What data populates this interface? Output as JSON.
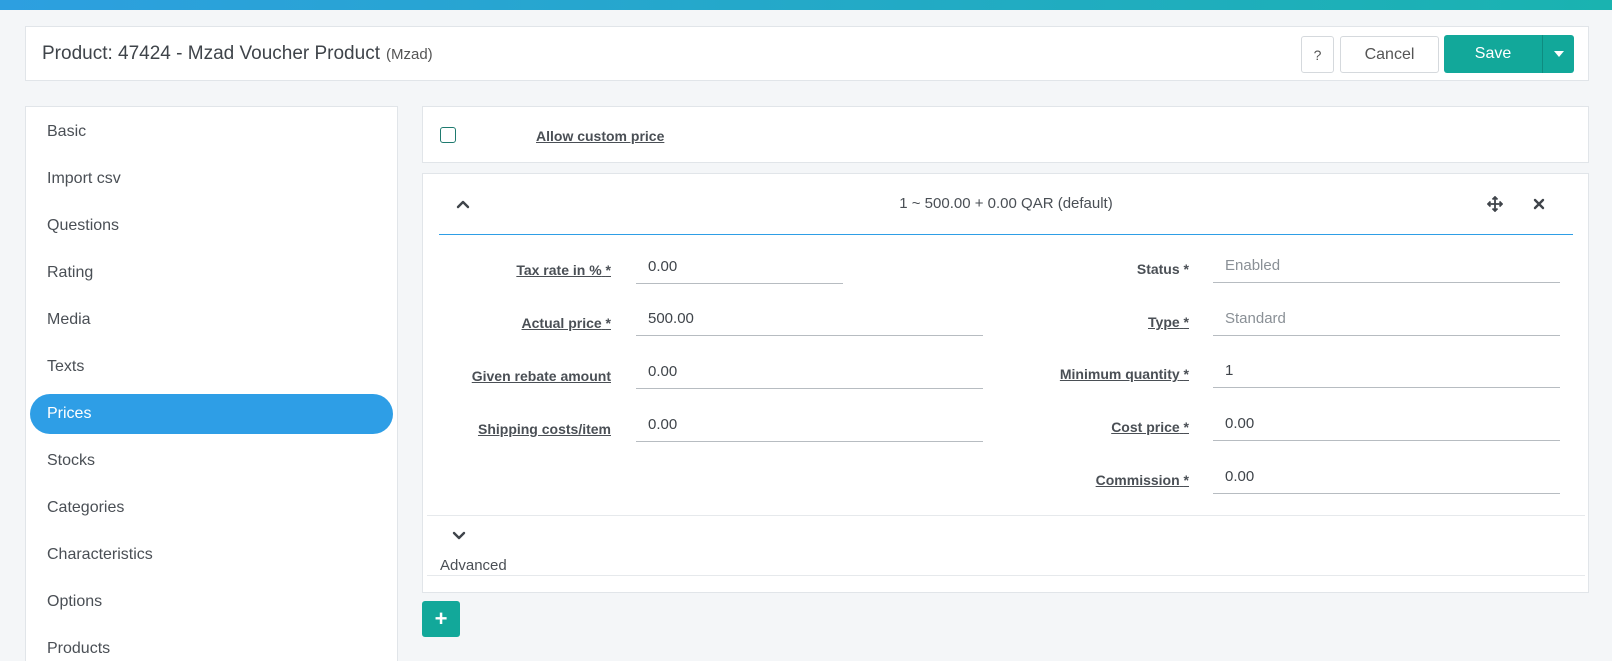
{
  "header": {
    "title": "Product: 47424 - Mzad Voucher Product",
    "subtitle": "(Mzad)",
    "help_label": "?",
    "cancel_label": "Cancel",
    "save_label": "Save"
  },
  "sidebar": {
    "items": [
      {
        "label": "Basic"
      },
      {
        "label": "Import csv"
      },
      {
        "label": "Questions"
      },
      {
        "label": "Rating"
      },
      {
        "label": "Media"
      },
      {
        "label": "Texts"
      },
      {
        "label": "Prices",
        "active": true
      },
      {
        "label": "Stocks"
      },
      {
        "label": "Categories"
      },
      {
        "label": "Characteristics"
      },
      {
        "label": "Options"
      },
      {
        "label": "Products"
      }
    ]
  },
  "custom_price": {
    "label": "Allow custom price",
    "checked": false
  },
  "price_tier": {
    "summary": "1 ~ 500.00 + 0.00 QAR (default)",
    "left_fields": [
      {
        "label": "Tax rate in %",
        "required": "*",
        "value": "0.00"
      },
      {
        "label": "Actual price",
        "required": "*",
        "value": "500.00"
      },
      {
        "label": "Given rebate amount",
        "required": "",
        "value": "0.00"
      },
      {
        "label": "Shipping costs/item",
        "required": "",
        "value": "0.00"
      }
    ],
    "right_fields": [
      {
        "label": "Status",
        "required": "*",
        "value": "Enabled"
      },
      {
        "label": "Type",
        "required": "*",
        "value": "Standard"
      },
      {
        "label": "Minimum quantity",
        "required": "*",
        "value": "1"
      },
      {
        "label": "Cost price",
        "required": "*",
        "value": "0.00"
      },
      {
        "label": "Commission",
        "required": "*",
        "value": "0.00"
      }
    ],
    "advanced_label": "Advanced"
  },
  "add_label": "+",
  "colors": {
    "accent": "#2e9ee6",
    "primary": "#12a89a"
  }
}
